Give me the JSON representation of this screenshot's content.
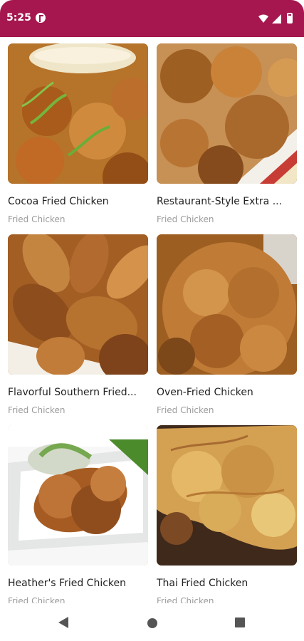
{
  "status": {
    "time": "5:25",
    "bar_color": "#a5174e"
  },
  "recipes": [
    {
      "title": "Cocoa Fried Chicken",
      "category": "Fried Chicken",
      "image_subject": "fried chicken pieces with dip and green onions"
    },
    {
      "title": "Restaurant-Style Extra ...",
      "category": "Fried Chicken",
      "image_subject": "crispy fried drumsticks on white plate"
    },
    {
      "title": "Flavorful Southern Fried...",
      "category": "Fried Chicken",
      "image_subject": "pile of fried chicken drumsticks"
    },
    {
      "title": "Oven-Fried Chicken",
      "category": "Fried Chicken",
      "image_subject": "close-up of golden oven-fried chicken"
    },
    {
      "title": "Heather's Fried Chicken",
      "category": "Fried Chicken",
      "image_subject": "fried chicken on plate with coleslaw"
    },
    {
      "title": "Thai Fried Chicken",
      "category": "Fried Chicken",
      "image_subject": "close-up of crispy seasoned chicken"
    }
  ],
  "navigation": {
    "back_icon": "triangle-back-icon",
    "home_icon": "circle-home-icon",
    "recents_icon": "square-recents-icon"
  }
}
